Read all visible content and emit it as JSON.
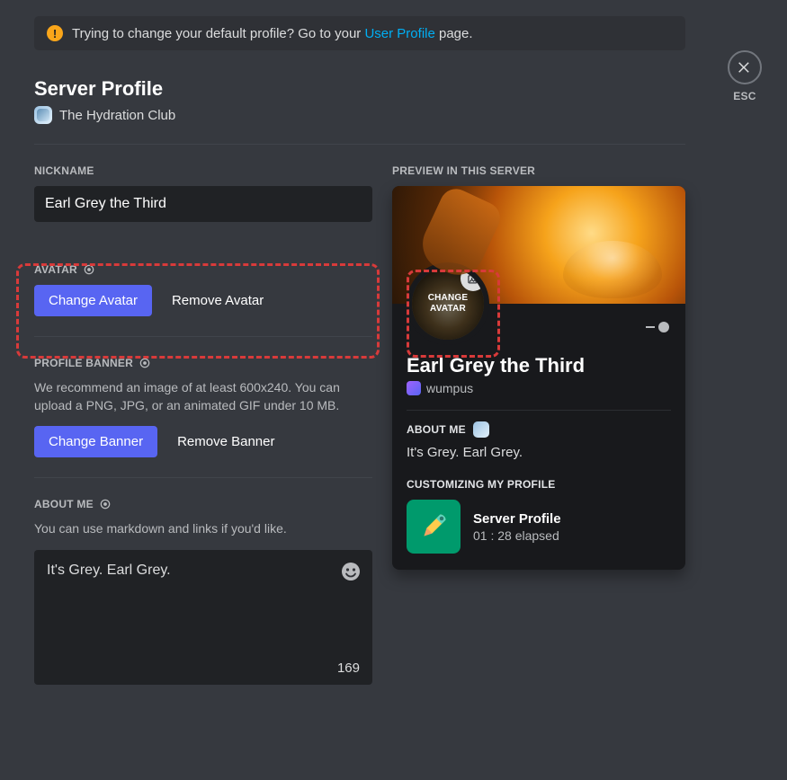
{
  "tip": {
    "prefix": "Trying to change your default profile? Go to your ",
    "link": "User Profile",
    "suffix": " page."
  },
  "close_label": "ESC",
  "page_title": "Server Profile",
  "server_name": "The Hydration Club",
  "left": {
    "nickname": {
      "label": "NICKNAME",
      "value": "Earl Grey the Third"
    },
    "avatar": {
      "label": "AVATAR",
      "change": "Change Avatar",
      "remove": "Remove Avatar"
    },
    "banner": {
      "label": "PROFILE BANNER",
      "help": "We recommend an image of at least 600x240. You can upload a PNG, JPG, or an animated GIF under 10 MB.",
      "change": "Change Banner",
      "remove": "Remove Banner"
    },
    "about": {
      "label": "ABOUT ME",
      "help": "You can use markdown and links if you'd like.",
      "value": "It's Grey. Earl Grey.",
      "remaining": "169"
    }
  },
  "preview": {
    "label": "PREVIEW IN THIS SERVER",
    "avatar_overlay": "CHANGE AVATAR",
    "display_name": "Earl Grey the Third",
    "username": "wumpus",
    "about_label": "ABOUT ME",
    "about_text": "It's Grey. Earl Grey.",
    "activity_label": "CUSTOMIZING MY PROFILE",
    "activity_name": "Server Profile",
    "activity_time": "01 : 28 elapsed"
  }
}
